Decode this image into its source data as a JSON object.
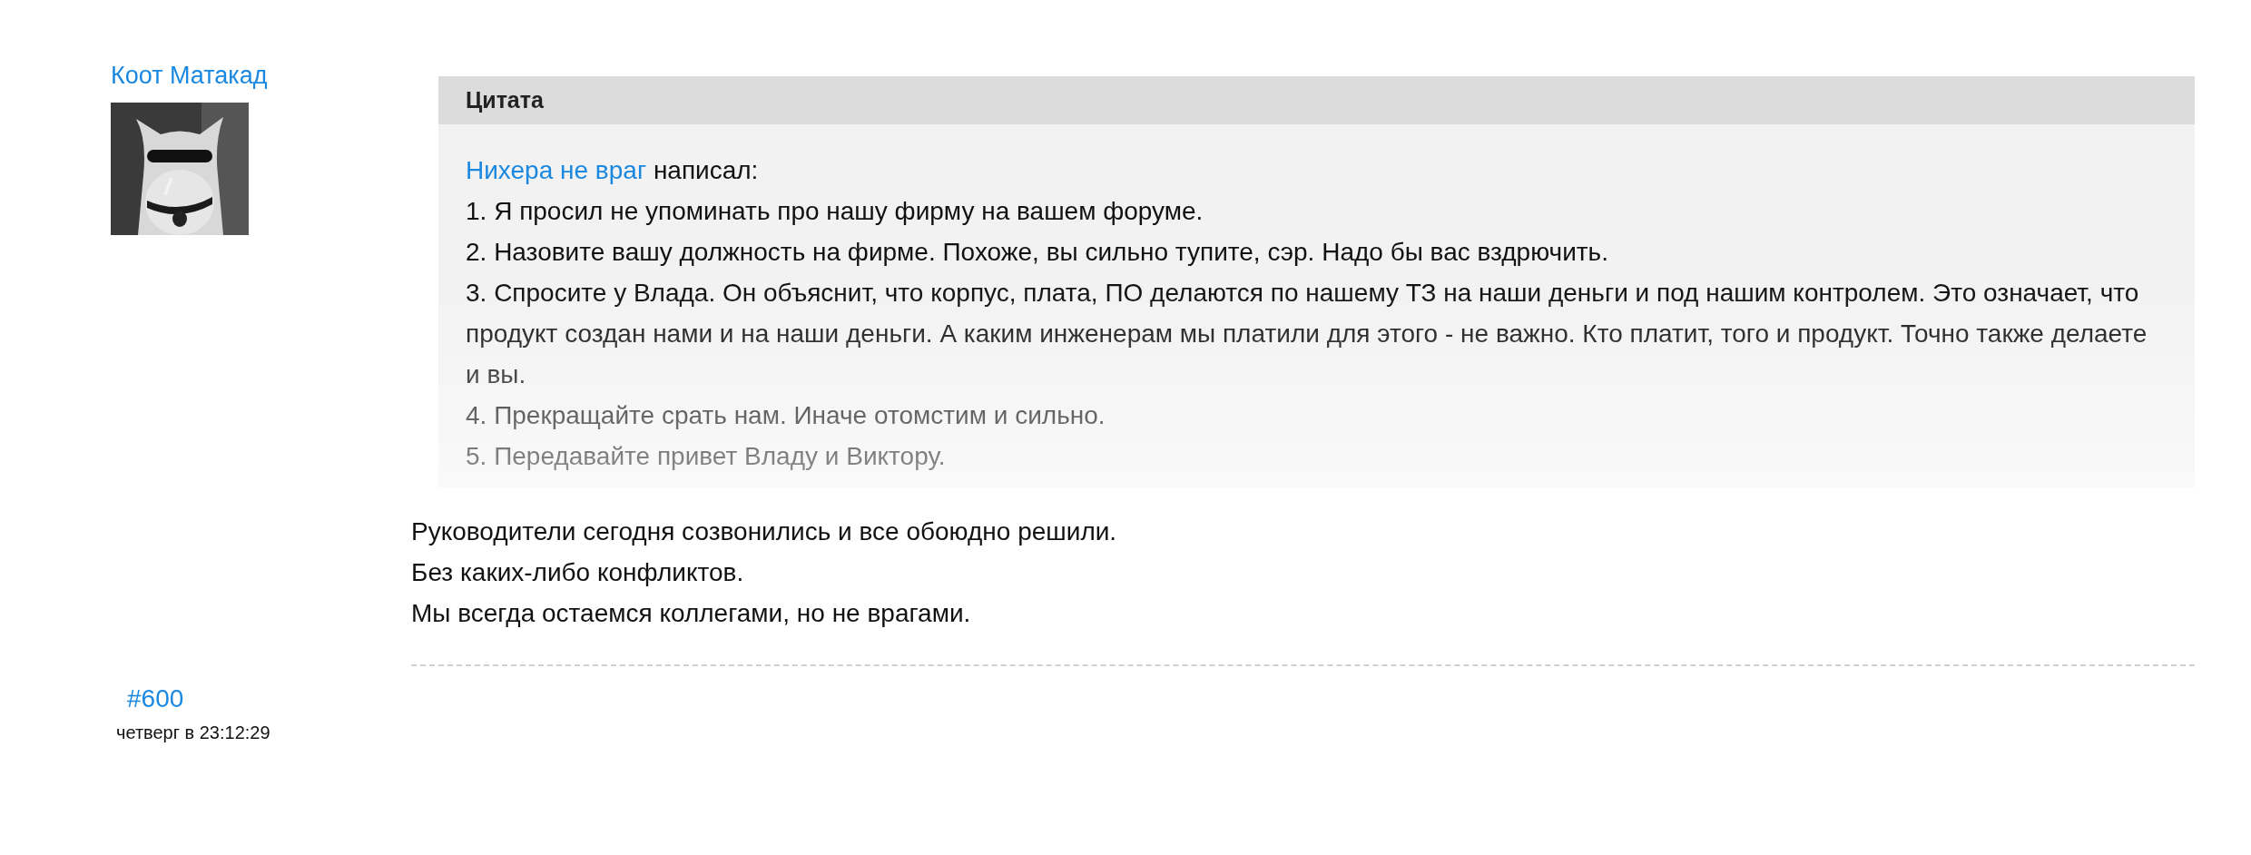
{
  "post": {
    "author": "Коот Матакад",
    "number": "#600",
    "time": "четверг в 23:12:29"
  },
  "quote": {
    "title": "Цитата",
    "source_author": "Нихера не враг",
    "source_verb": "написал:",
    "lines": [
      "1. Я просил не упоминать про нашу фирму на вашем форуме.",
      "2. Назовите вашу должность на фирме. Похоже, вы сильно тупите, сэр. Надо бы вас вздрючить.",
      "3. Спросите у Влада. Он объяснит, что корпус, плата, ПО делаются по нашему ТЗ на наши деньги и под нашим контролем. Это означает, что продукт создан нами и на наши деньги. А каким инженерам мы платили для этого - не важно. Кто платит, того и продукт. Точно также делаете и вы.",
      "4. Прекращайте срать нам. Иначе отомстим и сильно.",
      "5. Передавайте привет Владу и Виктору."
    ]
  },
  "body": [
    "Руководители сегодня созвонились и все обоюдно решили.",
    "Без каких-либо конфликтов.",
    "Мы всегда остаемся коллегами, но не врагами."
  ]
}
